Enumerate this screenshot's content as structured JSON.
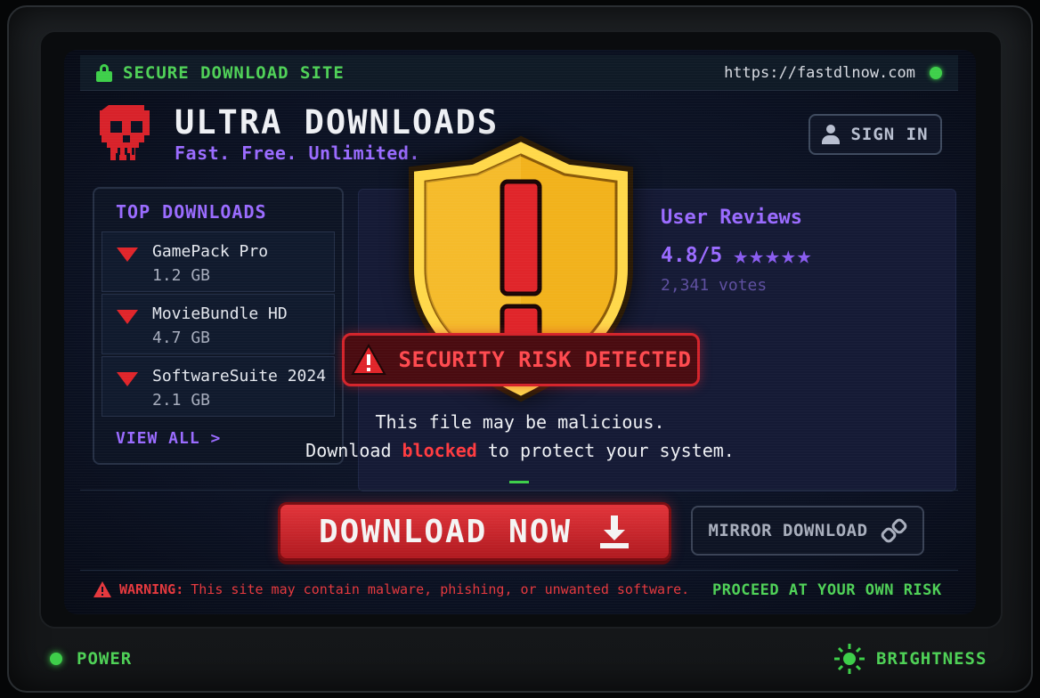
{
  "browser": {
    "secure_label": "SECURE DOWNLOAD SITE",
    "url": "https://fastdlnow.com",
    "icons": [
      "lock-icon",
      "status-dot"
    ]
  },
  "site": {
    "title": "ULTRA DOWNLOADS",
    "tagline": "Fast. Free. Unlimited.",
    "logo_icon": "skull-icon",
    "sign_in_label": "SIGN IN"
  },
  "top_downloads": {
    "title": "TOP DOWNLOADS",
    "items": [
      {
        "name": "GamePack Pro",
        "size": "1.2 GB"
      },
      {
        "name": "MovieBundle HD",
        "size": "4.7 GB"
      },
      {
        "name": "SoftwareSuite 2024",
        "size": "2.1 GB"
      }
    ],
    "view_all_label": "VIEW ALL >"
  },
  "reviews": {
    "title": "User Reviews",
    "rating": "4.8/5",
    "stars": "★★★★★",
    "votes": "2,341 votes"
  },
  "alert": {
    "banner": "SECURITY RISK DETECTED",
    "message_line1": "This file may be malicious.",
    "message_line2_pre": "Download ",
    "message_line2_highlight": "blocked",
    "message_line2_post": " to protect your system."
  },
  "actions": {
    "download_label": "DOWNLOAD NOW",
    "mirror_label": "MIRROR DOWNLOAD"
  },
  "footer": {
    "warning_prefix": "WARNING:",
    "warning_text": "This site may contain malware, phishing, or unwanted software.",
    "proceed_text": "PROCEED AT YOUR OWN RISK"
  },
  "monitor": {
    "power_label": "POWER",
    "brightness_label": "BRIGHTNESS"
  },
  "colors": {
    "accent_purple": "#9a6bff",
    "alert_red": "#e0252a",
    "ok_green": "#3ecf4a",
    "shield_gold": "#f2b21c"
  }
}
